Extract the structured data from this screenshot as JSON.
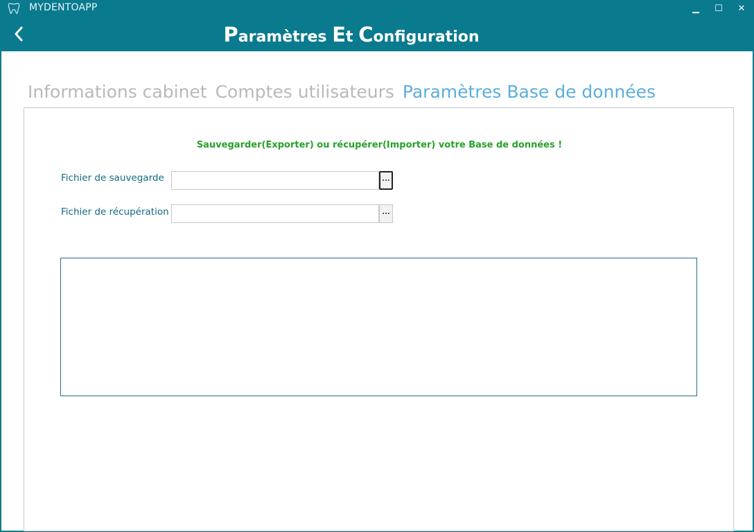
{
  "titlebar": {
    "app_name": "MYDENTOAPP",
    "minimize_glyph": "▁",
    "maximize_glyph": "☐",
    "close_glyph": "✕"
  },
  "header": {
    "title_parts": [
      {
        "cap": "P",
        "rest": "aramètres "
      },
      {
        "cap": "E",
        "rest": "t "
      },
      {
        "cap": "C",
        "rest": "onfiguration"
      }
    ]
  },
  "tabs": [
    {
      "label": "Informations cabinet",
      "active": false
    },
    {
      "label": "Comptes utilisateurs",
      "active": false
    },
    {
      "label": "Paramètres Base de données",
      "active": true
    }
  ],
  "panel": {
    "heading": "Sauvegarder(Exporter) ou récupérer(Importer) votre Base de données !",
    "backup_label": "Fichier de sauvegarde",
    "backup_value": "",
    "restore_label": "Fichier de récupération",
    "restore_value": "",
    "browse_label": "...",
    "log_text": ""
  },
  "colors": {
    "accent": "#0a7a8e",
    "active_tab": "#5aaedc",
    "inactive_tab": "#b9b9b9",
    "heading_green": "#26a12a",
    "label_teal": "#116a80"
  }
}
